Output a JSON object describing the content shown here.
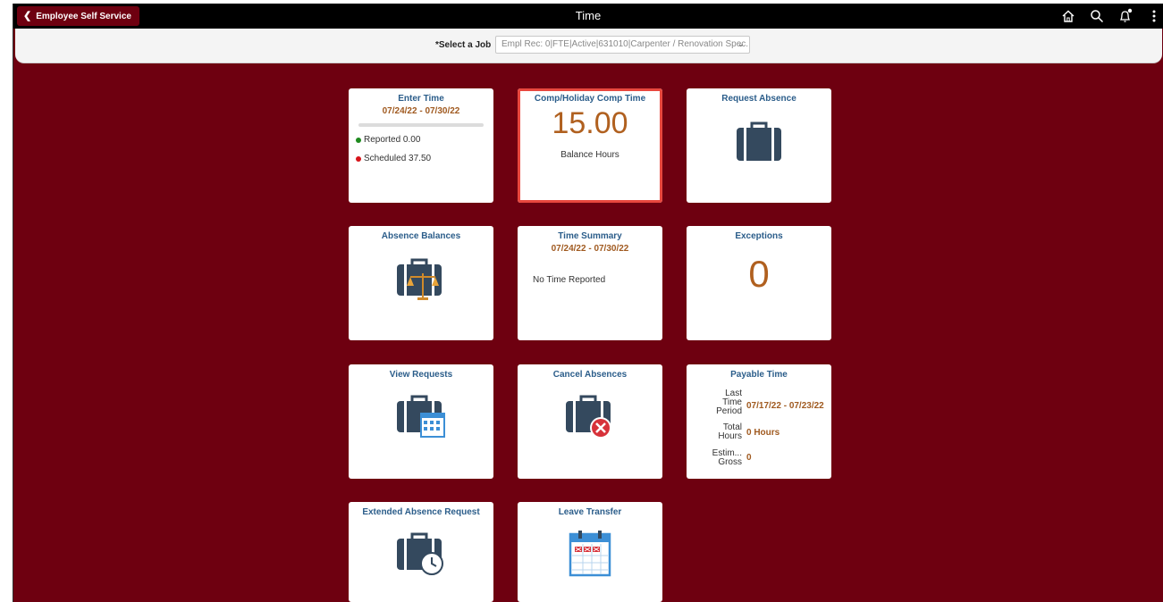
{
  "header": {
    "back_label": "Employee Self Service",
    "title": "Time",
    "icons": [
      "home-icon",
      "search-icon",
      "notification-icon",
      "more-icon"
    ]
  },
  "job": {
    "label": "*Select a Job",
    "selected": "Empl Rec: 0|FTE|Active|631010|Carpenter / Renovation Spec."
  },
  "tiles": {
    "enter_time": {
      "title": "Enter Time",
      "period": "07/24/22 - 07/30/22",
      "reported": "Reported 0.00",
      "scheduled": "Scheduled 37.50",
      "reported_color": "#1e8a1e",
      "scheduled_color": "#d7141a"
    },
    "comp_time": {
      "title": "Comp/Holiday Comp Time",
      "value": "15.00",
      "caption": "Balance Hours"
    },
    "request_absence": {
      "title": "Request Absence",
      "icon": "briefcase-icon"
    },
    "absence_balances": {
      "title": "Absence Balances",
      "icon": "briefcase-scale-icon"
    },
    "time_summary": {
      "title": "Time Summary",
      "period": "07/24/22 - 07/30/22",
      "message": "No Time Reported"
    },
    "exceptions": {
      "title": "Exceptions",
      "value": "0"
    },
    "view_requests": {
      "title": "View Requests",
      "icon": "briefcase-calendar-icon"
    },
    "cancel_absences": {
      "title": "Cancel Absences",
      "icon": "briefcase-cancel-icon"
    },
    "payable_time": {
      "title": "Payable Time",
      "rows": [
        {
          "label_lines": [
            "Last",
            "Time",
            "Period"
          ],
          "value": "07/17/22 - 07/23/22"
        },
        {
          "label_lines": [
            "Total",
            "Hours"
          ],
          "value": "0 Hours"
        },
        {
          "label_lines": [
            "Estim...",
            "Gross"
          ],
          "value": "0"
        }
      ]
    },
    "extended_absence": {
      "title": "Extended Absence Request",
      "icon": "briefcase-clock-icon"
    },
    "leave_transfer": {
      "title": "Leave Transfer",
      "icon": "calendar-icon"
    }
  },
  "colors": {
    "background": "#6e0010",
    "tile_title": "#2b5d8a",
    "accent_orange": "#b0601f",
    "selected_outline": "#e8473e"
  }
}
